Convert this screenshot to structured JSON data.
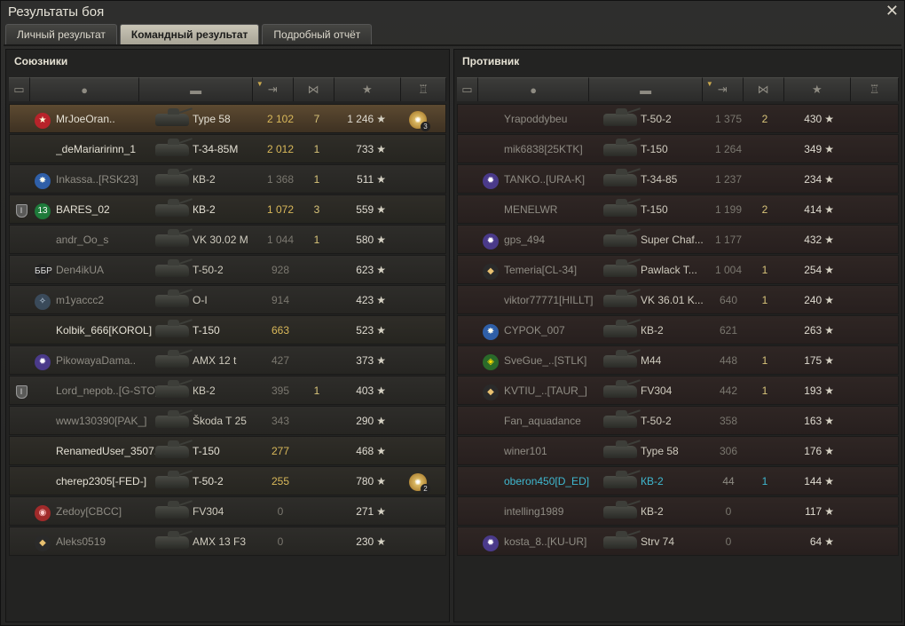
{
  "window": {
    "title": "Результаты боя"
  },
  "tabs": [
    {
      "label": "Личный результат",
      "active": false
    },
    {
      "label": "Командный результат",
      "active": true
    },
    {
      "label": "Подробный отчёт",
      "active": false
    }
  ],
  "allies": {
    "title": "Союзники",
    "players": [
      {
        "name": "MrJoeOran..",
        "tank": "Type 58",
        "xp": "2 102",
        "kills": "7",
        "damage": "1 246",
        "emblem": "red-star",
        "medal": "3",
        "rank": "",
        "style": "highlight"
      },
      {
        "name": "_deMariaririnn_1",
        "tank": "T-34-85M",
        "xp": "2 012",
        "kills": "1",
        "damage": "733",
        "emblem": "",
        "medal": "",
        "rank": "",
        "style": "alive"
      },
      {
        "name": "Inkassa..[RSK23]",
        "tank": "КВ-2",
        "xp": "1 368",
        "kills": "1",
        "damage": "511",
        "emblem": "blue-star",
        "medal": "",
        "rank": "",
        "style": "dead"
      },
      {
        "name": "BARES_02",
        "tank": "КВ-2",
        "xp": "1 072",
        "kills": "3",
        "damage": "559",
        "emblem": "green-13",
        "medal": "",
        "rank": "I",
        "style": "alive"
      },
      {
        "name": "andr_Oo_s",
        "tank": "VK 30.02 M",
        "xp": "1 044",
        "kills": "1",
        "damage": "580",
        "emblem": "",
        "medal": "",
        "rank": "",
        "style": "dead"
      },
      {
        "name": "Den4ikUA",
        "tank": "T-50-2",
        "xp": "928",
        "kills": "",
        "damage": "623",
        "emblem": "bbr",
        "medal": "",
        "rank": "",
        "style": "dead"
      },
      {
        "name": "m1yaccc2",
        "tank": "O-I",
        "xp": "914",
        "kills": "",
        "damage": "423",
        "emblem": "compass",
        "medal": "",
        "rank": "",
        "style": "dead"
      },
      {
        "name": "Kolbik_666[KOROL]",
        "tank": "T-150",
        "xp": "663",
        "kills": "",
        "damage": "523",
        "emblem": "",
        "medal": "",
        "rank": "",
        "style": "alive"
      },
      {
        "name": "PikowayaDama..",
        "tank": "AMX 12 t",
        "xp": "427",
        "kills": "",
        "damage": "373",
        "emblem": "purple-star",
        "medal": "",
        "rank": "",
        "style": "dead"
      },
      {
        "name": "Lord_nepob..[G-STO]",
        "tank": "КВ-2",
        "xp": "395",
        "kills": "1",
        "damage": "403",
        "emblem": "",
        "medal": "",
        "rank": "I",
        "style": "dead"
      },
      {
        "name": "www130390[PAK_]",
        "tank": "Škoda T 25",
        "xp": "343",
        "kills": "",
        "damage": "290",
        "emblem": "",
        "medal": "",
        "rank": "",
        "style": "dead"
      },
      {
        "name": "RenamedUser_3507..",
        "tank": "T-150",
        "xp": "277",
        "kills": "",
        "damage": "468",
        "emblem": "",
        "medal": "",
        "rank": "",
        "style": "alive"
      },
      {
        "name": "cherep2305[-FED-]",
        "tank": "T-50-2",
        "xp": "255",
        "kills": "",
        "damage": "780",
        "emblem": "",
        "medal": "2",
        "rank": "",
        "style": "alive"
      },
      {
        "name": "Zedoy[CBCC]",
        "tank": "FV304",
        "xp": "0",
        "kills": "",
        "damage": "271",
        "emblem": "red-circle",
        "medal": "",
        "rank": "",
        "style": "dead"
      },
      {
        "name": "Aleks0519",
        "tank": "AMX 13 F3",
        "xp": "0",
        "kills": "",
        "damage": "230",
        "emblem": "diamond",
        "medal": "",
        "rank": "",
        "style": "dead"
      }
    ]
  },
  "enemies": {
    "title": "Противник",
    "players": [
      {
        "name": "Yrapoddybeu",
        "tank": "T-50-2",
        "xp": "1 375",
        "kills": "2",
        "damage": "430",
        "emblem": "",
        "style": "dead"
      },
      {
        "name": "mik6838[25KTK]",
        "tank": "T-150",
        "xp": "1 264",
        "kills": "",
        "damage": "349",
        "emblem": "",
        "style": "dead"
      },
      {
        "name": "TANKO..[URA-K]",
        "tank": "T-34-85",
        "xp": "1 237",
        "kills": "",
        "damage": "234",
        "emblem": "purple-star",
        "style": "dead"
      },
      {
        "name": "MENELWR",
        "tank": "T-150",
        "xp": "1 199",
        "kills": "2",
        "damage": "414",
        "emblem": "",
        "style": "dead"
      },
      {
        "name": "gps_494",
        "tank": "Super Chaf...",
        "xp": "1 177",
        "kills": "",
        "damage": "432",
        "emblem": "purple-star",
        "style": "dead"
      },
      {
        "name": "Temeria[CL-34]",
        "tank": "Pawlack T...",
        "xp": "1 004",
        "kills": "1",
        "damage": "254",
        "emblem": "diamond",
        "style": "dead"
      },
      {
        "name": "viktor77771[HILLT]",
        "tank": "VK 36.01 K...",
        "xp": "640",
        "kills": "1",
        "damage": "240",
        "emblem": "",
        "style": "dead"
      },
      {
        "name": "CYPOK_007",
        "tank": "КВ-2",
        "xp": "621",
        "kills": "",
        "damage": "263",
        "emblem": "blue-star",
        "style": "dead"
      },
      {
        "name": "SveGue_..[STLK]",
        "tank": "M44",
        "xp": "448",
        "kills": "1",
        "damage": "175",
        "emblem": "green-shield",
        "style": "dead"
      },
      {
        "name": "KVTIU_..[TAUR_]",
        "tank": "FV304",
        "xp": "442",
        "kills": "1",
        "damage": "193",
        "emblem": "diamond",
        "style": "dead"
      },
      {
        "name": "Fan_aquadance",
        "tank": "T-50-2",
        "xp": "358",
        "kills": "",
        "damage": "163",
        "emblem": "",
        "style": "dead"
      },
      {
        "name": "winer101",
        "tank": "Type 58",
        "xp": "306",
        "kills": "",
        "damage": "176",
        "emblem": "",
        "style": "dead"
      },
      {
        "name": "oberon450[D_ED]",
        "tank": "КВ-2",
        "xp": "44",
        "kills": "1",
        "damage": "144",
        "emblem": "",
        "style": "cyan"
      },
      {
        "name": "intelling1989",
        "tank": "КВ-2",
        "xp": "0",
        "kills": "",
        "damage": "117",
        "emblem": "",
        "style": "dead"
      },
      {
        "name": "kosta_8..[KU-UR]",
        "tank": "Strv 74",
        "xp": "0",
        "kills": "",
        "damage": "64",
        "emblem": "purple-star",
        "style": "dead"
      }
    ]
  },
  "icons": {
    "star": "★",
    "close": "✕"
  }
}
